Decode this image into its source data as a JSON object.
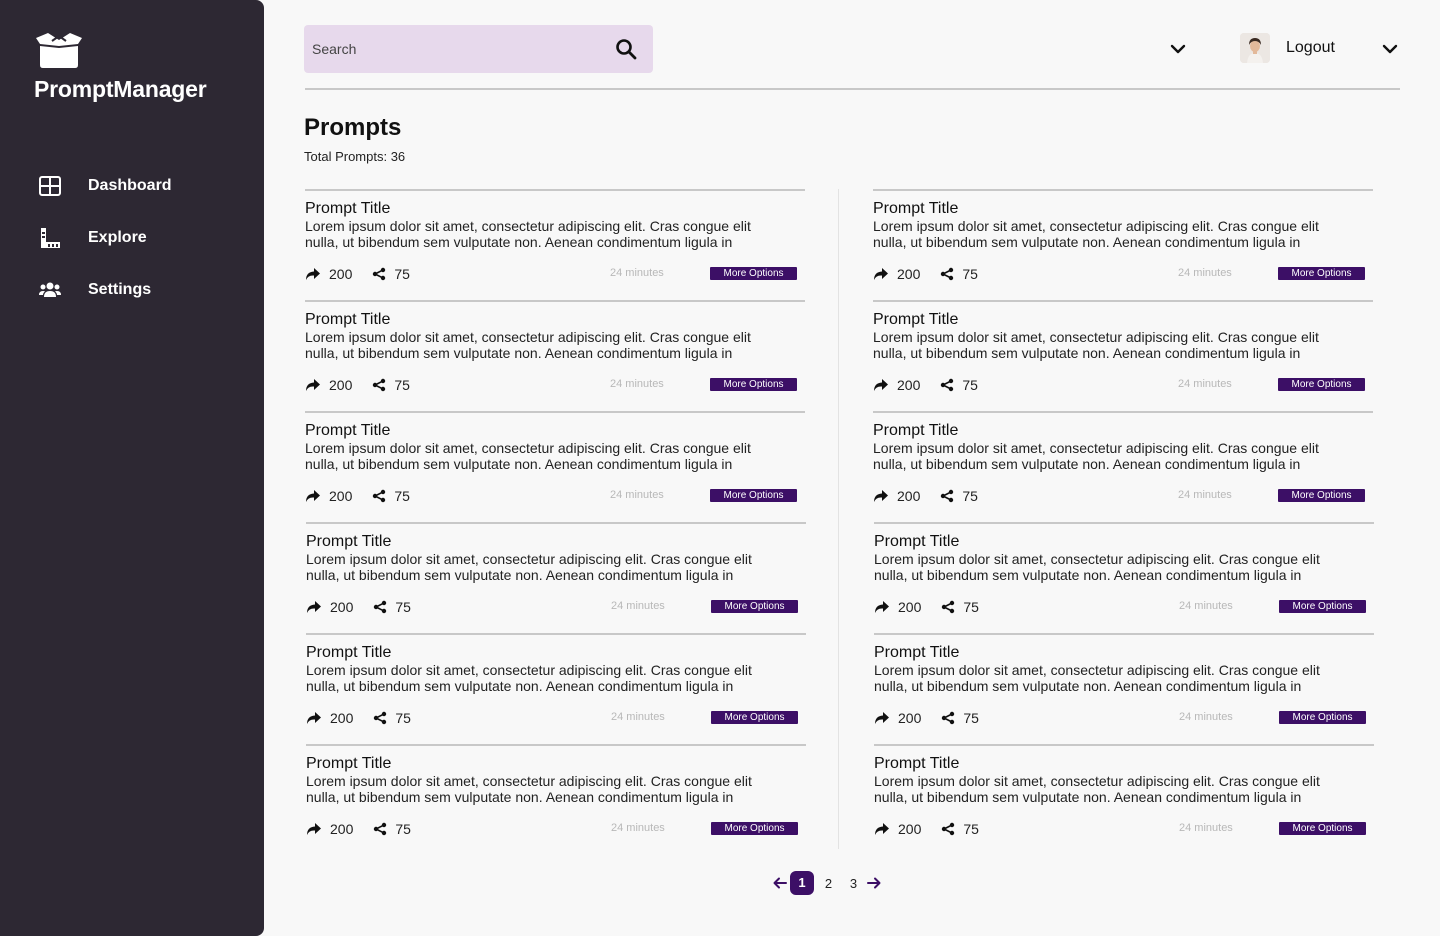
{
  "app": {
    "name": "PromptManager"
  },
  "sidebar": {
    "items": [
      {
        "label": "Dashboard",
        "icon": "dashboard-grid-icon"
      },
      {
        "label": "Explore",
        "icon": "ruler-icon"
      },
      {
        "label": "Settings",
        "icon": "users-icon"
      }
    ]
  },
  "search": {
    "placeholder": "Search"
  },
  "user": {
    "logout_label": "Logout"
  },
  "page": {
    "title": "Prompts",
    "total_label": "Total Prompts: 36"
  },
  "prompts": [
    {
      "title": "Prompt Title",
      "description": "Lorem ipsum dolor sit amet, consectetur adipiscing elit. Cras congue elit nulla, ut bibendum sem vulputate non. Aenean condimentum ligula in",
      "shares": "200",
      "forks": "75",
      "time": "24 minutes",
      "more_label": "More Options"
    },
    {
      "title": "Prompt Title",
      "description": "Lorem ipsum dolor sit amet, consectetur adipiscing elit. Cras congue elit nulla, ut bibendum sem vulputate non. Aenean condimentum ligula in",
      "shares": "200",
      "forks": "75",
      "time": "24 minutes",
      "more_label": "More Options"
    },
    {
      "title": "Prompt Title",
      "description": "Lorem ipsum dolor sit amet, consectetur adipiscing elit. Cras congue elit nulla, ut bibendum sem vulputate non. Aenean condimentum ligula in",
      "shares": "200",
      "forks": "75",
      "time": "24 minutes",
      "more_label": "More Options"
    },
    {
      "title": "Prompt Title",
      "description": "Lorem ipsum dolor sit amet, consectetur adipiscing elit. Cras congue elit nulla, ut bibendum sem vulputate non. Aenean condimentum ligula in",
      "shares": "200",
      "forks": "75",
      "time": "24 minutes",
      "more_label": "More Options"
    },
    {
      "title": "Prompt Title",
      "description": "Lorem ipsum dolor sit amet, consectetur adipiscing elit. Cras congue elit nulla, ut bibendum sem vulputate non. Aenean condimentum ligula in",
      "shares": "200",
      "forks": "75",
      "time": "24 minutes",
      "more_label": "More Options"
    },
    {
      "title": "Prompt Title",
      "description": "Lorem ipsum dolor sit amet, consectetur adipiscing elit. Cras congue elit nulla, ut bibendum sem vulputate non. Aenean condimentum ligula in",
      "shares": "200",
      "forks": "75",
      "time": "24 minutes",
      "more_label": "More Options"
    },
    {
      "title": "Prompt Title",
      "description": "Lorem ipsum dolor sit amet, consectetur adipiscing elit. Cras congue elit nulla, ut bibendum sem vulputate non. Aenean condimentum ligula in",
      "shares": "200",
      "forks": "75",
      "time": "24 minutes",
      "more_label": "More Options"
    },
    {
      "title": "Prompt Title",
      "description": "Lorem ipsum dolor sit amet, consectetur adipiscing elit. Cras congue elit nulla, ut bibendum sem vulputate non. Aenean condimentum ligula in",
      "shares": "200",
      "forks": "75",
      "time": "24 minutes",
      "more_label": "More Options"
    },
    {
      "title": "Prompt Title",
      "description": "Lorem ipsum dolor sit amet, consectetur adipiscing elit. Cras congue elit nulla, ut bibendum sem vulputate non. Aenean condimentum ligula in",
      "shares": "200",
      "forks": "75",
      "time": "24 minutes",
      "more_label": "More Options"
    },
    {
      "title": "Prompt Title",
      "description": "Lorem ipsum dolor sit amet, consectetur adipiscing elit. Cras congue elit nulla, ut bibendum sem vulputate non. Aenean condimentum ligula in",
      "shares": "200",
      "forks": "75",
      "time": "24 minutes",
      "more_label": "More Options"
    },
    {
      "title": "Prompt Title",
      "description": "Lorem ipsum dolor sit amet, consectetur adipiscing elit. Cras congue elit nulla, ut bibendum sem vulputate non. Aenean condimentum ligula in",
      "shares": "200",
      "forks": "75",
      "time": "24 minutes",
      "more_label": "More Options"
    },
    {
      "title": "Prompt Title",
      "description": "Lorem ipsum dolor sit amet, consectetur adipiscing elit. Cras congue elit nulla, ut bibendum sem vulputate non. Aenean condimentum ligula in",
      "shares": "200",
      "forks": "75",
      "time": "24 minutes",
      "more_label": "More Options"
    }
  ],
  "pagination": {
    "pages": [
      "1",
      "2",
      "3"
    ],
    "current": "1"
  },
  "colors": {
    "sidebar_bg": "#2d2833",
    "accent": "#3c0f66",
    "search_bg": "#e7d9ec"
  }
}
